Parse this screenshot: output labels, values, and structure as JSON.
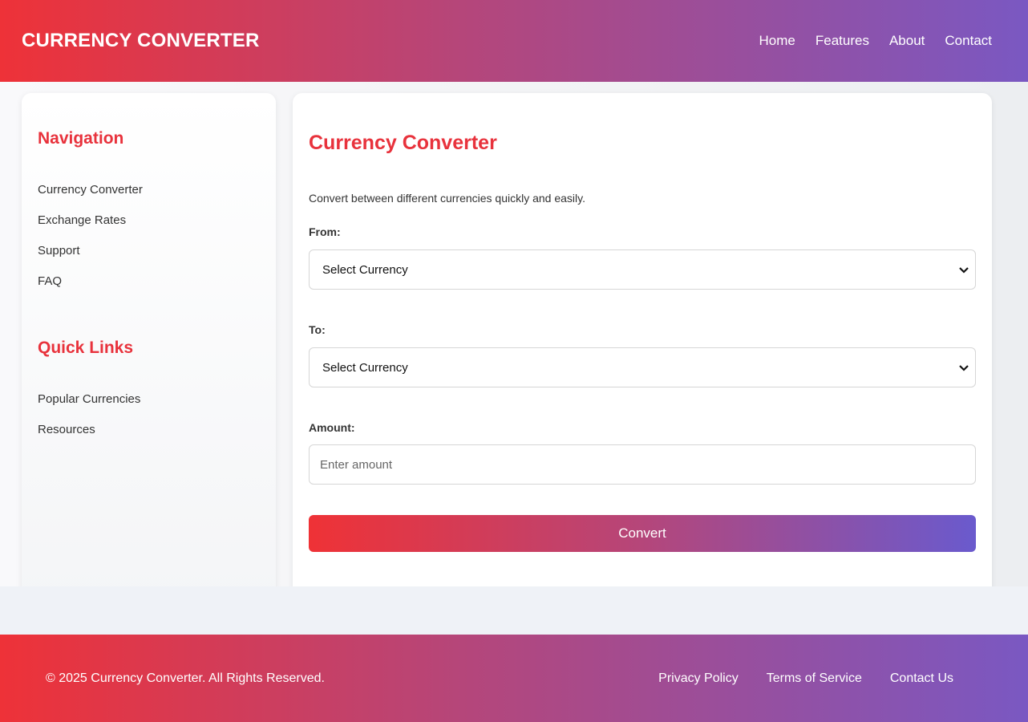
{
  "header": {
    "logo": "CURRENCY CONVERTER",
    "nav": [
      "Home",
      "Features",
      "About",
      "Contact"
    ]
  },
  "sidebar": {
    "navigation_heading": "Navigation",
    "navigation_items": [
      "Currency Converter",
      "Exchange Rates",
      "Support",
      "FAQ"
    ],
    "quick_links_heading": "Quick Links",
    "quick_links_items": [
      "Popular Currencies",
      "Resources"
    ]
  },
  "main": {
    "title": "Currency Converter",
    "description": "Convert between different currencies quickly and easily.",
    "from_label": "From:",
    "from_value": "Select Currency",
    "to_label": "To:",
    "to_value": "Select Currency",
    "amount_label": "Amount:",
    "amount_placeholder": "Enter amount",
    "convert_label": "Convert"
  },
  "footer": {
    "copyright": "© 2025 Currency Converter. All Rights Reserved.",
    "links": [
      "Privacy Policy",
      "Terms of Service",
      "Contact Us"
    ]
  },
  "colors": {
    "accent_red": "#e8323c",
    "gradient_start": "#ee3238",
    "gradient_end": "#7a58c2"
  },
  "icons": {
    "select_chevron": "chevron-down-icon"
  }
}
